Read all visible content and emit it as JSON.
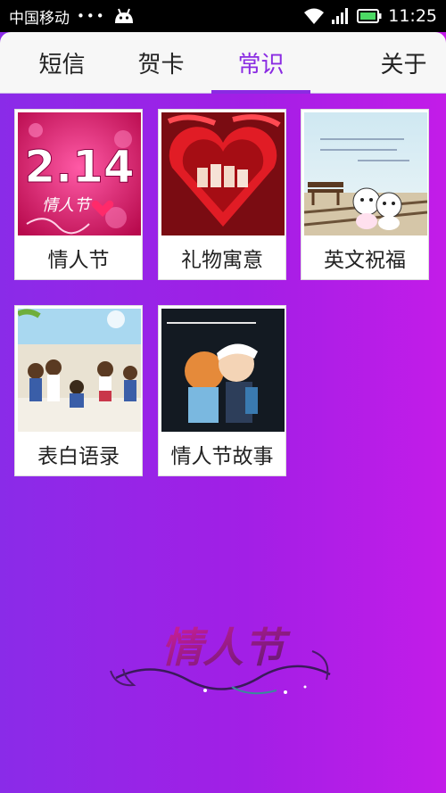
{
  "status_bar": {
    "carrier": "中国移动",
    "dots": "•••",
    "time": "11:25"
  },
  "tabs": [
    {
      "label": "短信",
      "active": false
    },
    {
      "label": "贺卡",
      "active": false
    },
    {
      "label": "常识",
      "active": true
    },
    {
      "label": "关于",
      "active": false
    }
  ],
  "cards": [
    {
      "label": "情人节",
      "image": "valentine-214-image",
      "image_text": "2.14",
      "image_subtext": "情人节"
    },
    {
      "label": "礼物寓意",
      "image": "heart-gift-box-image"
    },
    {
      "label": "英文祝福",
      "image": "cartoon-couple-railway-image"
    },
    {
      "label": "表白语录",
      "image": "cartoon-students-confession-image"
    },
    {
      "label": "情人节故事",
      "image": "cartoon-kiss-image"
    }
  ],
  "logo": {
    "text": "情人节"
  },
  "colors": {
    "accent": "#8a2be2",
    "background_start": "#8a2be8",
    "background_end": "#c31ce8",
    "battery": "#4cd964"
  }
}
